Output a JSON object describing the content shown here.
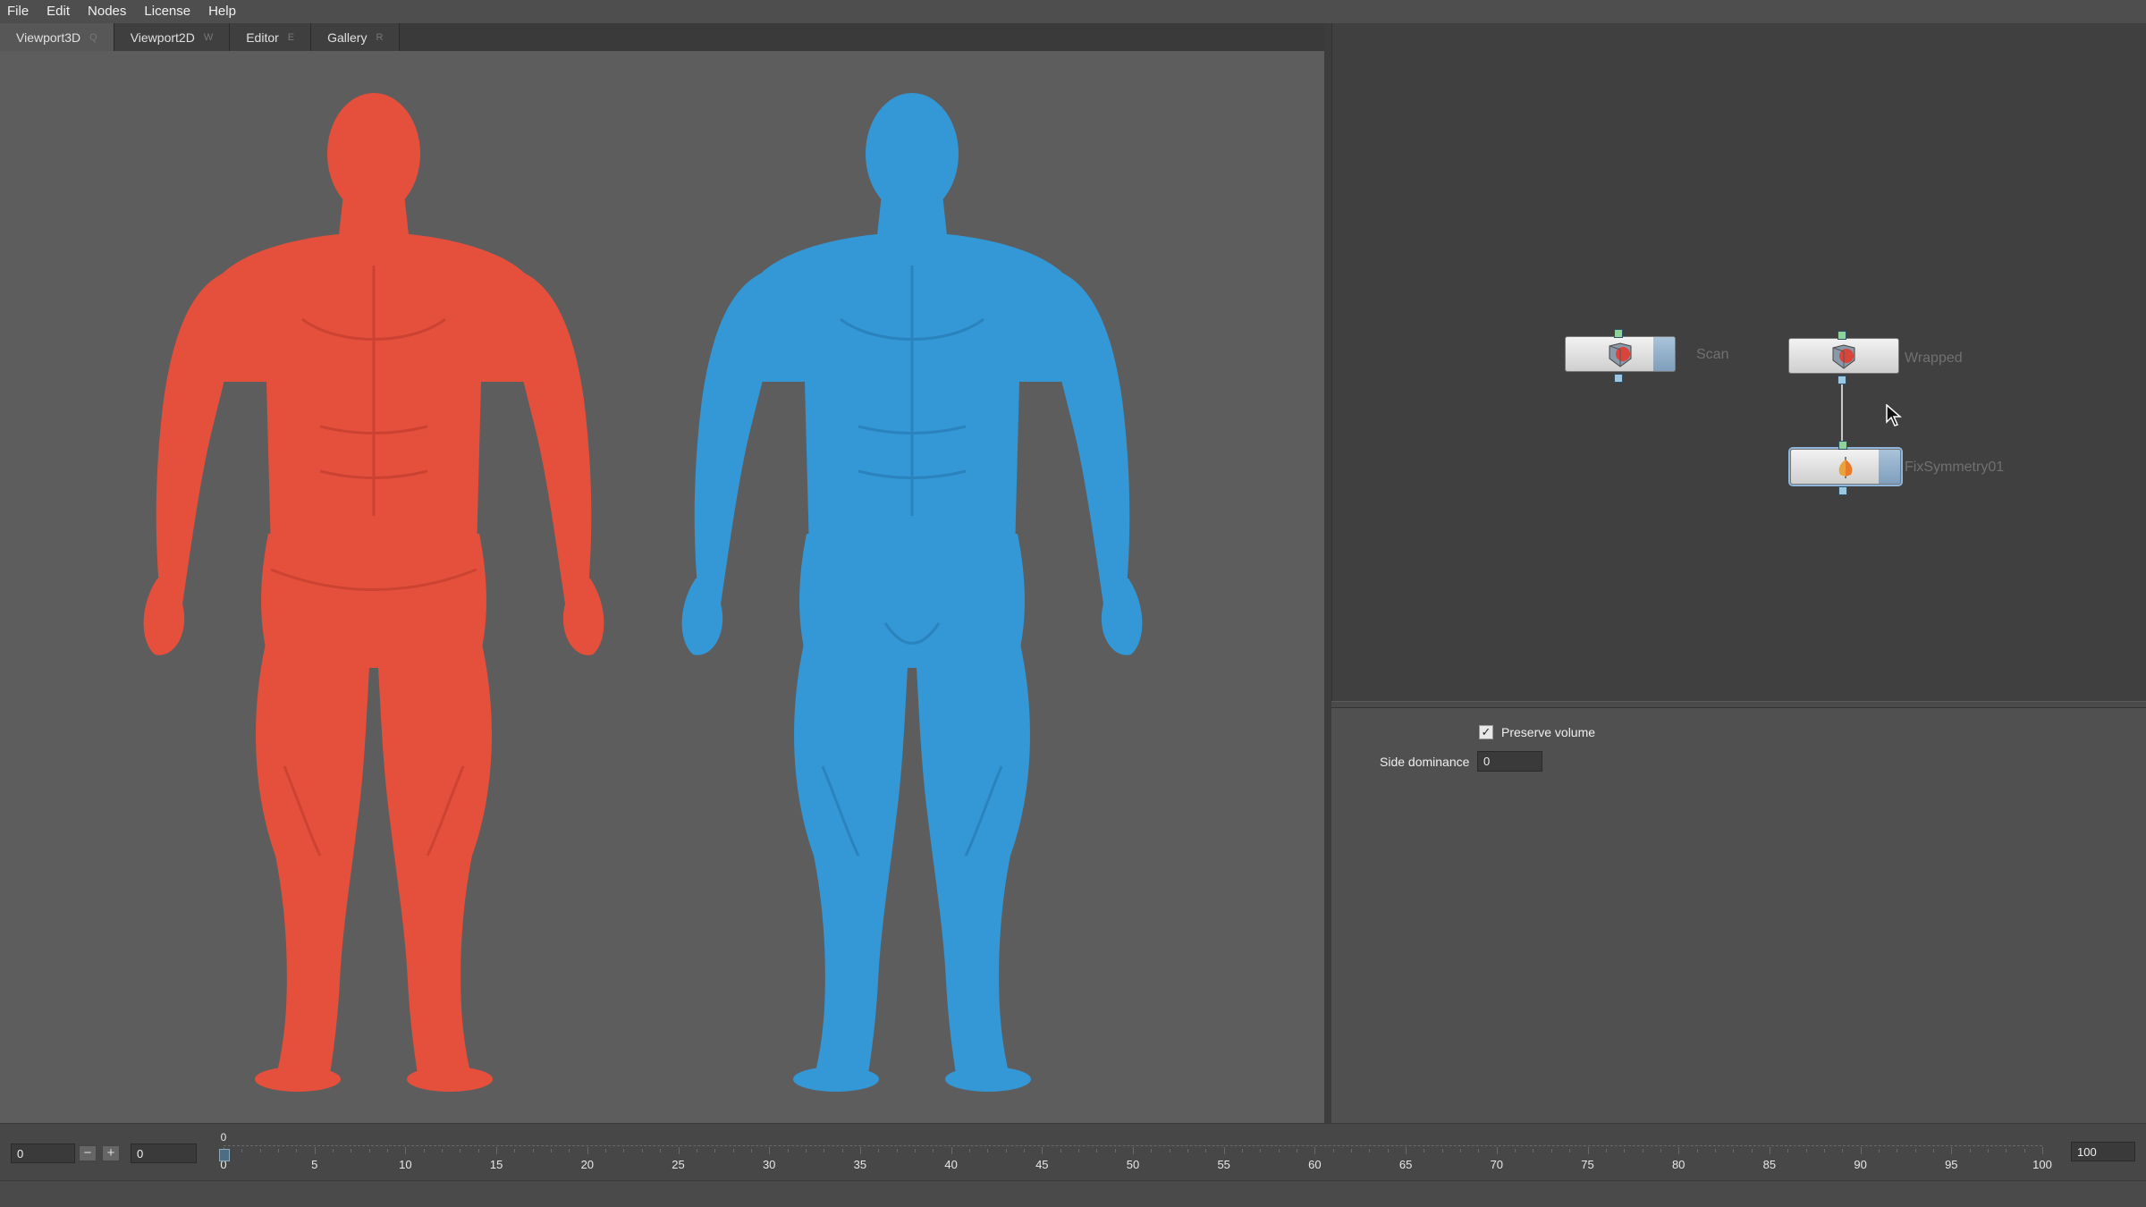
{
  "menu": [
    "File",
    "Edit",
    "Nodes",
    "License",
    "Help"
  ],
  "tabs": [
    {
      "label": "Viewport3D",
      "hotkey": "Q"
    },
    {
      "label": "Viewport2D",
      "hotkey": "W"
    },
    {
      "label": "Editor",
      "hotkey": "E"
    },
    {
      "label": "Gallery",
      "hotkey": "R"
    }
  ],
  "viewport": {
    "models": [
      {
        "name": "scan-model",
        "color": "#e5503c"
      },
      {
        "name": "wrapped-model",
        "color": "#3497d6"
      }
    ]
  },
  "nodes": [
    {
      "label": "Scan",
      "icon": "wrap-icon"
    },
    {
      "label": "Wrapped",
      "icon": "wrap-icon"
    },
    {
      "label": "FixSymmetry01",
      "icon": "symmetry-icon",
      "selected": true
    }
  ],
  "properties": {
    "preserve_volume": {
      "label": "Preserve volume",
      "checked": true
    },
    "side_dominance": {
      "label": "Side dominance",
      "value": "0"
    }
  },
  "timeline": {
    "start": "0",
    "current": "0",
    "end": "100",
    "cursor": "0",
    "ticks": [
      "0",
      "5",
      "10",
      "15",
      "20",
      "25",
      "30",
      "35",
      "40",
      "45",
      "50",
      "55",
      "60",
      "65",
      "70",
      "75",
      "80",
      "85",
      "90",
      "95",
      "100"
    ]
  },
  "colors": {
    "scan": "#e5503c",
    "wrapped": "#3497d6",
    "node_strip": "#8fb0cc",
    "background": "#5d5d5d"
  }
}
